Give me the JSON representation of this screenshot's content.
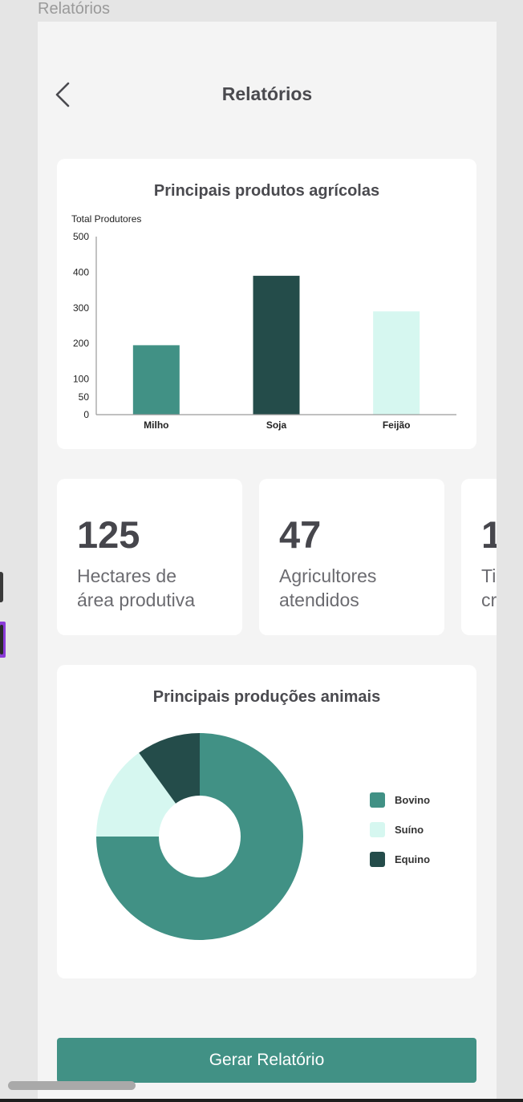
{
  "frame_label": "Relatórios",
  "header": {
    "title": "Relatórios"
  },
  "bar_chart": {
    "title": "Principais produtos agrícolas",
    "chart_data": {
      "type": "bar",
      "categories": [
        "Milho",
        "Soja",
        "Feijão"
      ],
      "values": [
        195,
        390,
        290
      ],
      "colors": [
        "#419185",
        "#244c4a",
        "#d6f7f0"
      ],
      "ylabel": "Total Produtores",
      "ylim": [
        0,
        500
      ],
      "yticks": [
        0,
        50,
        100,
        200,
        300,
        400,
        500
      ],
      "ytick_labels": [
        "0",
        "50",
        "100",
        "200",
        "300",
        "400",
        "500"
      ]
    }
  },
  "stats": [
    {
      "value": "125",
      "label": "Hectares de\nárea produtiva"
    },
    {
      "value": "47",
      "label": "Agricultores\natendidos"
    },
    {
      "value": "1",
      "label": "Ti\ncr"
    }
  ],
  "pie_chart": {
    "title": "Principais produções animais",
    "chart_data": {
      "type": "pie",
      "labels": [
        "Bovino",
        "Suíno",
        "Equino"
      ],
      "values": [
        75,
        15,
        10
      ],
      "colors": [
        "#419185",
        "#d6f7f0",
        "#244c4a"
      ],
      "donut": true,
      "legend": "right"
    }
  },
  "button": {
    "label": "Gerar Relatório"
  }
}
